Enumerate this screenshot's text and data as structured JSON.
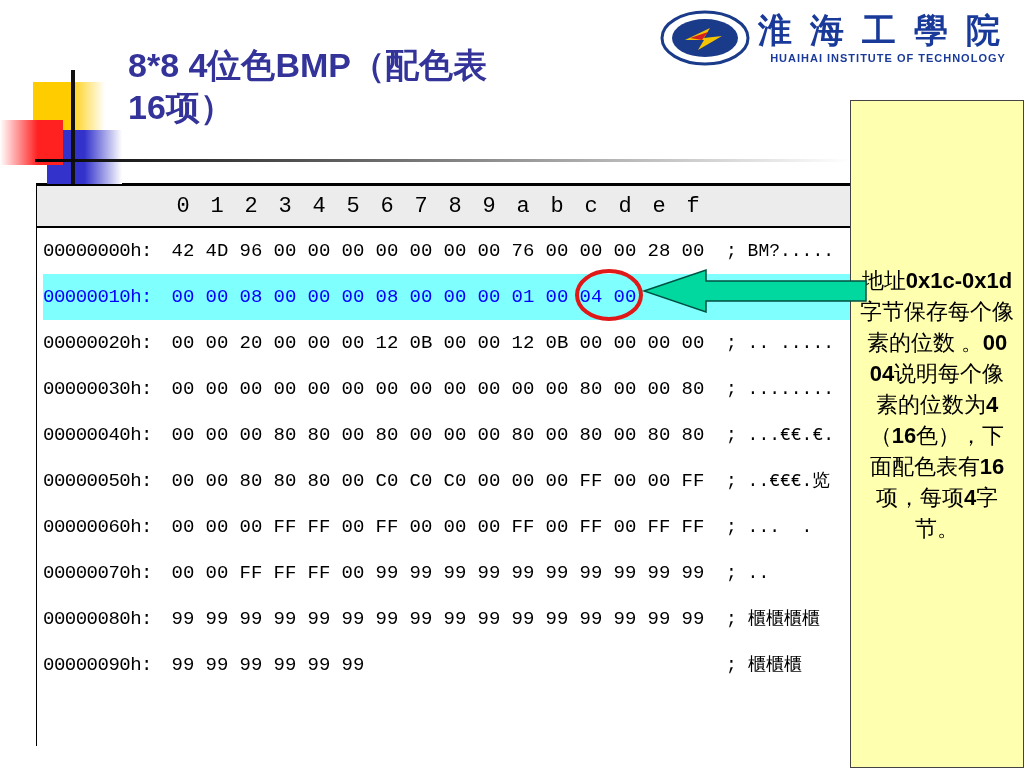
{
  "title": "8*8 4位色BMP（配色表16项）",
  "logo": {
    "name_cn": "淮海工學院",
    "name_en": "HUAIHAI INSTITUTE OF TECHNOLOGY"
  },
  "hex": {
    "columns": [
      "0",
      "1",
      "2",
      "3",
      "4",
      "5",
      "6",
      "7",
      "8",
      "9",
      "a",
      "b",
      "c",
      "d",
      "e",
      "f"
    ],
    "rows": [
      {
        "address": "00000000h:",
        "bytes": [
          "42",
          "4D",
          "96",
          "00",
          "00",
          "00",
          "00",
          "00",
          "00",
          "00",
          "76",
          "00",
          "00",
          "00",
          "28",
          "00"
        ],
        "ascii": "; BM?.....",
        "selected": false
      },
      {
        "address": "00000010h:",
        "bytes": [
          "00",
          "00",
          "08",
          "00",
          "00",
          "00",
          "08",
          "00",
          "00",
          "00",
          "01",
          "00",
          "04",
          "00"
        ],
        "selected": true
      },
      {
        "address": "00000020h:",
        "bytes": [
          "00",
          "00",
          "20",
          "00",
          "00",
          "00",
          "12",
          "0B",
          "00",
          "00",
          "12",
          "0B",
          "00",
          "00",
          "00",
          "00"
        ],
        "ascii": "; .. .....",
        "selected": false
      },
      {
        "address": "00000030h:",
        "bytes": [
          "00",
          "00",
          "00",
          "00",
          "00",
          "00",
          "00",
          "00",
          "00",
          "00",
          "00",
          "00",
          "80",
          "00",
          "00",
          "80"
        ],
        "ascii": "; ........",
        "selected": false
      },
      {
        "address": "00000040h:",
        "bytes": [
          "00",
          "00",
          "00",
          "80",
          "80",
          "00",
          "80",
          "00",
          "00",
          "00",
          "80",
          "00",
          "80",
          "00",
          "80",
          "80"
        ],
        "ascii": "; ...€€.€.",
        "selected": false
      },
      {
        "address": "00000050h:",
        "bytes": [
          "00",
          "00",
          "80",
          "80",
          "80",
          "00",
          "C0",
          "C0",
          "C0",
          "00",
          "00",
          "00",
          "FF",
          "00",
          "00",
          "FF"
        ],
        "ascii": "; ..€€€.览",
        "selected": false
      },
      {
        "address": "00000060h:",
        "bytes": [
          "00",
          "00",
          "00",
          "FF",
          "FF",
          "00",
          "FF",
          "00",
          "00",
          "00",
          "FF",
          "00",
          "FF",
          "00",
          "FF",
          "FF"
        ],
        "ascii": "; ...  . ",
        "selected": false
      },
      {
        "address": "00000070h:",
        "bytes": [
          "00",
          "00",
          "FF",
          "FF",
          "FF",
          "00",
          "99",
          "99",
          "99",
          "99",
          "99",
          "99",
          "99",
          "99",
          "99",
          "99"
        ],
        "ascii": "; ..",
        "selected": false
      },
      {
        "address": "00000080h:",
        "bytes": [
          "99",
          "99",
          "99",
          "99",
          "99",
          "99",
          "99",
          "99",
          "99",
          "99",
          "99",
          "99",
          "99",
          "99",
          "99",
          "99"
        ],
        "ascii": "; 櫃櫃櫃櫃",
        "selected": false
      },
      {
        "address": "00000090h:",
        "bytes": [
          "99",
          "99",
          "99",
          "99",
          "99",
          "99"
        ],
        "ascii": "; 櫃櫃櫃",
        "selected": false
      }
    ]
  },
  "callout": "地址**0x1c-0x1d**字节保存每个像素的位数 。**00 04**说明每个像素的位数为**4** （**16**色），下面配色表有**16**项，每项**4**字节。"
}
